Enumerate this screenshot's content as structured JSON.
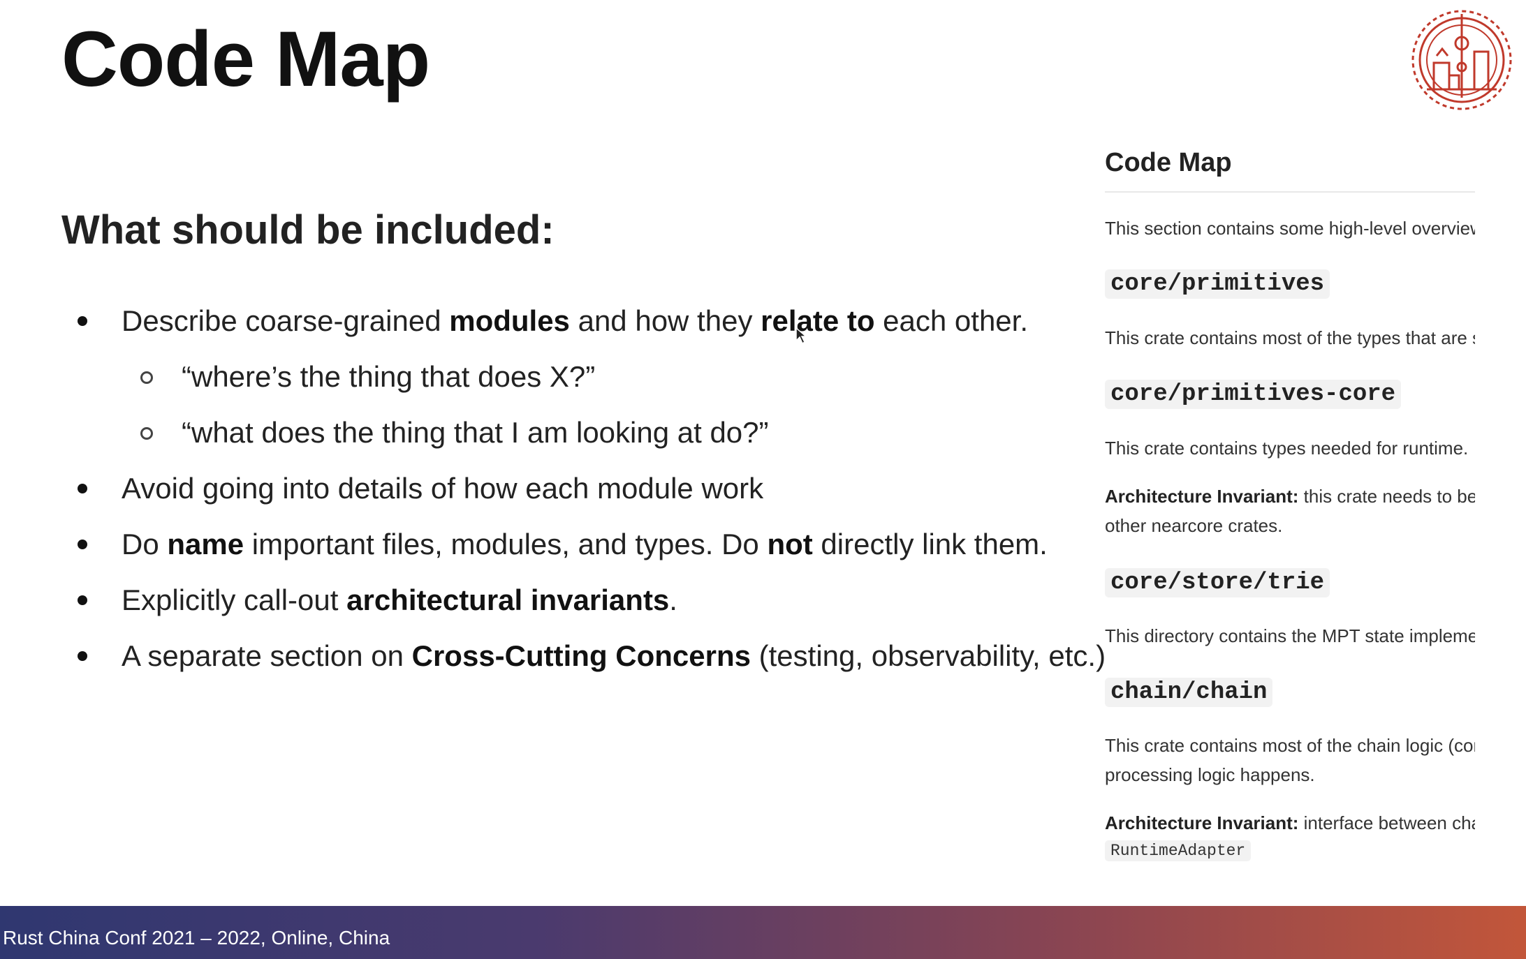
{
  "slide": {
    "title": "Code Map",
    "heading": "What should be included:",
    "bullets": [
      {
        "pre": "Describe coarse-grained ",
        "b1": "modules",
        "mid": " and how they ",
        "b2": "relate to",
        "post": " each other."
      },
      {
        "text": "“where’s the thing that does X?”"
      },
      {
        "text": "“what does the thing that I am looking at do?”"
      },
      {
        "text": "Avoid going into details of how each module work"
      },
      {
        "pre": "Do ",
        "b1": "name",
        "mid": " important files, modules, and types. Do ",
        "b2": "not",
        "post": " directly link them."
      },
      {
        "pre": "Explicitly call-out ",
        "b1": "architectural invariants",
        "post": "."
      },
      {
        "pre": "A separate section on ",
        "b1": "Cross-Cutting Concerns",
        "post": " (testing, observability, etc.)"
      }
    ]
  },
  "doc": {
    "title": "Code Map",
    "intro": "This section contains some high-level overview",
    "sections": [
      {
        "code": "core/primitives",
        "text": "This crate contains most of the types that are s"
      },
      {
        "code": "core/primitives-core",
        "text": "This crate contains types needed for runtime.",
        "inv_label": "Architecture Invariant:",
        "inv_text": " this crate needs to be p",
        "inv_text2": "other nearcore crates."
      },
      {
        "code": "core/store/trie",
        "text": "This directory contains the MPT state impleme"
      },
      {
        "code": "chain/chain",
        "text": "This crate contains most of the chain logic (cor",
        "text2": "processing logic happens.",
        "inv_label": "Architecture Invariant:",
        "inv_text": " interface between chai",
        "inline_code": "RuntimeAdapter"
      }
    ]
  },
  "footer": {
    "text": "Rust China Conf 2021 – 2022, Online, China"
  },
  "colors": {
    "footer_start": "#2f3770",
    "footer_end": "#c2563a",
    "logo": "#c0392b"
  },
  "icons": {
    "logo": "conference-gear-logo-icon",
    "cursor": "mouse-pointer-icon"
  }
}
